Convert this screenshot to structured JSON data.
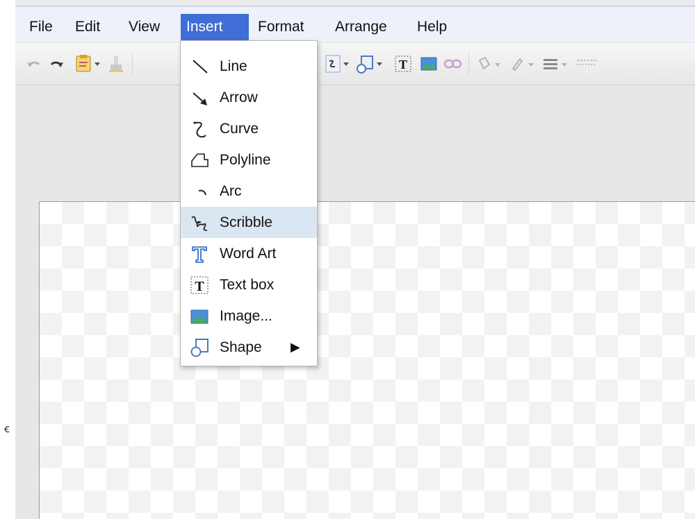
{
  "menubar": {
    "items": [
      {
        "label": "File"
      },
      {
        "label": "Edit"
      },
      {
        "label": "View"
      },
      {
        "label": "Insert",
        "active": true
      },
      {
        "label": "Format"
      },
      {
        "label": "Arrange"
      },
      {
        "label": "Help"
      }
    ]
  },
  "insert_menu": {
    "items": [
      {
        "label": "Line",
        "icon": "line-icon"
      },
      {
        "label": "Arrow",
        "icon": "arrow-icon"
      },
      {
        "label": "Curve",
        "icon": "curve-icon"
      },
      {
        "label": "Polyline",
        "icon": "polyline-icon"
      },
      {
        "label": "Arc",
        "icon": "arc-icon"
      },
      {
        "label": "Scribble",
        "icon": "scribble-icon",
        "highlighted": true
      },
      {
        "label": "Word Art",
        "icon": "word-art-icon"
      },
      {
        "label": "Text box",
        "icon": "text-box-icon"
      },
      {
        "label": "Image...",
        "icon": "image-icon"
      },
      {
        "label": "Shape",
        "icon": "shape-icon",
        "submenu_glyph": "▶"
      }
    ]
  },
  "toolbar": {
    "text_box_glyph": "T",
    "icons": [
      "undo-icon",
      "redo-icon",
      "paste-format-icon",
      "paint-format-icon",
      "line-tool-icon",
      "shape-tool-icon",
      "text-box-icon",
      "image-icon",
      "link-icon",
      "fill-color-icon",
      "line-color-icon",
      "line-weight-icon",
      "line-dash-icon"
    ]
  },
  "edge_mark": "ꞓ",
  "colors": {
    "menu_active_bg": "#3f6ed6",
    "menu_highlight_bg": "#dbe6f3",
    "menubar_bg": "#eef1f9"
  }
}
